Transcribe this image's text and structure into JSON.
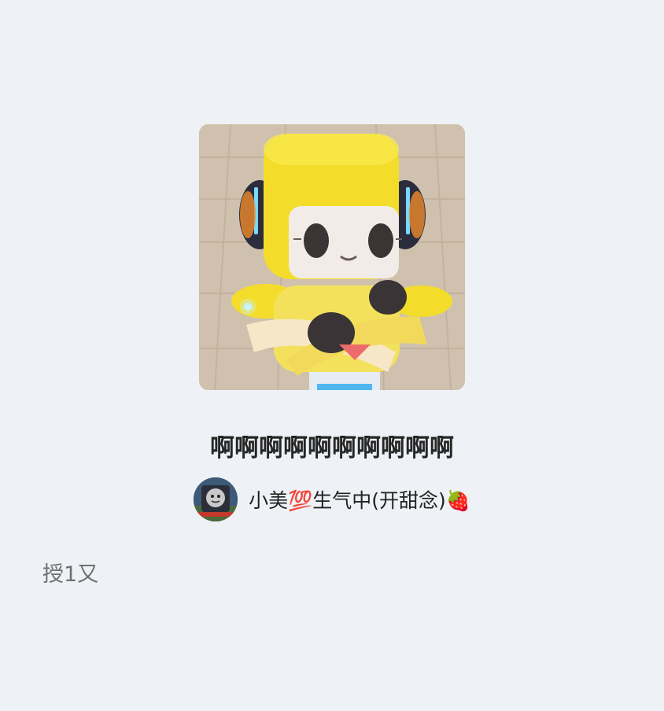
{
  "post": {
    "title": "啊啊啊啊啊啊啊啊啊啊",
    "author_name": "小美💯生气中(开甜念)🍓",
    "description": "授1又"
  },
  "images": {
    "cover": "yellow-robot-character-image",
    "avatar": "train-character-avatar"
  },
  "colors": {
    "background": "#eef1f5",
    "title_text": "#262626",
    "description_text": "#6f6f6f",
    "robot_yellow": "#f4dd2a"
  }
}
